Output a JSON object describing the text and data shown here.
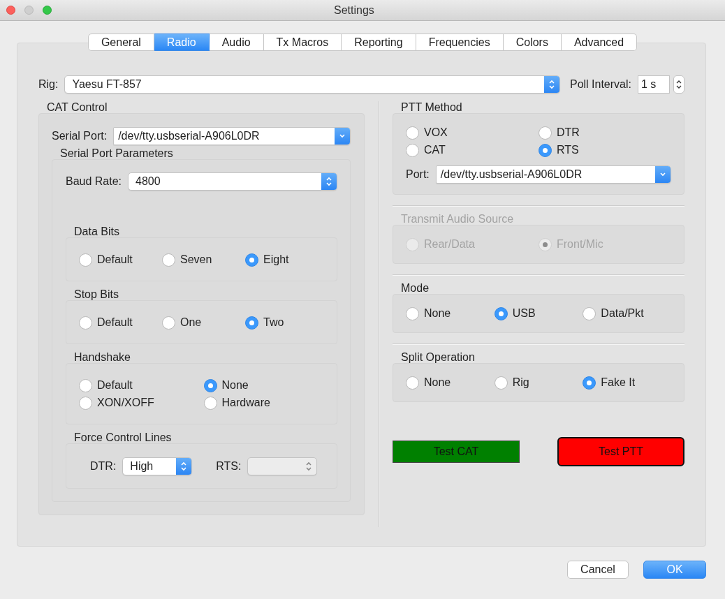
{
  "window": {
    "title": "Settings"
  },
  "tabs": [
    {
      "label": "General",
      "selected": false
    },
    {
      "label": "Radio",
      "selected": true
    },
    {
      "label": "Audio",
      "selected": false
    },
    {
      "label": "Tx Macros",
      "selected": false
    },
    {
      "label": "Reporting",
      "selected": false
    },
    {
      "label": "Frequencies",
      "selected": false
    },
    {
      "label": "Colors",
      "selected": false
    },
    {
      "label": "Advanced",
      "selected": false
    }
  ],
  "rig": {
    "label": "Rig:",
    "value": "Yaesu FT-857",
    "kind": "popup"
  },
  "poll_interval": {
    "label": "Poll Interval:",
    "value": "1 s"
  },
  "cat_control": {
    "title": "CAT Control",
    "serial_port": {
      "label": "Serial Port:",
      "value": "/dev/tty.usbserial-A906L0DR",
      "kind": "combo"
    },
    "parameters": {
      "title": "Serial Port Parameters",
      "baud_rate": {
        "label": "Baud Rate:",
        "value": "4800",
        "kind": "popup"
      },
      "groups": [
        {
          "title": "Data Bits",
          "kind": "radio_row",
          "options": [
            {
              "label": "Default",
              "selected": false
            },
            {
              "label": "Seven",
              "selected": false
            },
            {
              "label": "Eight",
              "selected": true
            }
          ]
        },
        {
          "title": "Stop Bits",
          "kind": "radio_row",
          "options": [
            {
              "label": "Default",
              "selected": false
            },
            {
              "label": "One",
              "selected": false
            },
            {
              "label": "Two",
              "selected": true
            }
          ]
        },
        {
          "title": "Handshake",
          "kind": "radio_grid",
          "options": [
            {
              "label": "Default",
              "selected": false
            },
            {
              "label": "None",
              "selected": true
            },
            {
              "label": "XON/XOFF",
              "selected": false
            },
            {
              "label": "Hardware",
              "selected": false
            }
          ]
        },
        {
          "title": "Force Control Lines",
          "kind": "lines",
          "fields": [
            {
              "label": "DTR:",
              "value": "High",
              "kind": "popup",
              "disabled": false
            },
            {
              "label": "RTS:",
              "kind": "popup",
              "disabled": true
            }
          ]
        }
      ]
    }
  },
  "sections": [
    {
      "title": "PTT Method",
      "kind": "radio_grid",
      "disabled": false,
      "options": [
        {
          "label": "VOX",
          "selected": false
        },
        {
          "label": "DTR",
          "selected": false
        },
        {
          "label": "CAT",
          "selected": false
        },
        {
          "label": "RTS",
          "selected": true
        }
      ],
      "port": {
        "label": "Port:",
        "value": "/dev/tty.usbserial-A906L0DR",
        "kind": "combo"
      }
    },
    {
      "title": "Transmit Audio Source",
      "kind": "radio_row",
      "disabled": true,
      "options": [
        {
          "label": "Rear/Data",
          "selected": false
        },
        {
          "label": "Front/Mic",
          "selected": true
        }
      ]
    },
    {
      "title": "Mode",
      "kind": "radio_row",
      "disabled": false,
      "options": [
        {
          "label": "None",
          "selected": false
        },
        {
          "label": "USB",
          "selected": true
        },
        {
          "label": "Data/Pkt",
          "selected": false
        }
      ]
    },
    {
      "title": "Split Operation",
      "kind": "radio_row",
      "disabled": false,
      "options": [
        {
          "label": "None",
          "selected": false
        },
        {
          "label": "Rig",
          "selected": false
        },
        {
          "label": "Fake It",
          "selected": true
        }
      ]
    }
  ],
  "test_buttons": [
    {
      "label": "Test CAT",
      "color": "#008000",
      "kind": "flat"
    },
    {
      "label": "Test PTT",
      "color": "#ff0000",
      "kind": "rounded"
    }
  ],
  "buttons": [
    {
      "label": "Cancel",
      "default": false
    },
    {
      "label": "OK",
      "default": true
    }
  ]
}
